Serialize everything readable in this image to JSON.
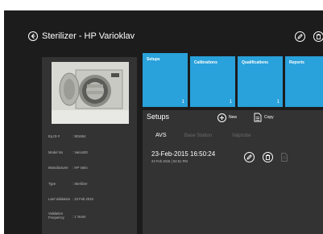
{
  "header": {
    "title": "Sterilizer - HP Varioklav"
  },
  "equipment": {
    "properties": [
      {
        "label": "Eq ID #",
        "value": ": 901654"
      },
      {
        "label": "Model No",
        "value": ": Vario400"
      },
      {
        "label": "Manufacturer",
        "value": ": HP Vario"
      },
      {
        "label": "Type",
        "value": ": Sterilizer"
      },
      {
        "label": "Last Validation",
        "value": ": 23 Feb 2015"
      },
      {
        "label": "Validation Frequency",
        "value": ": 1 Years"
      }
    ]
  },
  "tiles": [
    {
      "label": "Setups",
      "count": "1"
    },
    {
      "label": "Calibrations",
      "count": "1"
    },
    {
      "label": "Qualifications",
      "count": "1"
    },
    {
      "label": "Reports",
      "count": ""
    }
  ],
  "setups": {
    "title": "Setups",
    "new_label": "New",
    "copy_label": "Copy",
    "tabs": [
      "AVS",
      "Base Station",
      "Valprobe"
    ],
    "entry": {
      "datetime": "23-Feb-2015 16:50:24",
      "subtitle": "23 Feb 2015 | 04:51 PM"
    }
  },
  "colors": {
    "accent": "#29a1db",
    "background": "#1c1c1c",
    "panel": "#333333"
  },
  "icons": [
    "back-icon",
    "edit-icon",
    "delete-icon",
    "add-icon",
    "copy-icon",
    "file-icon"
  ]
}
